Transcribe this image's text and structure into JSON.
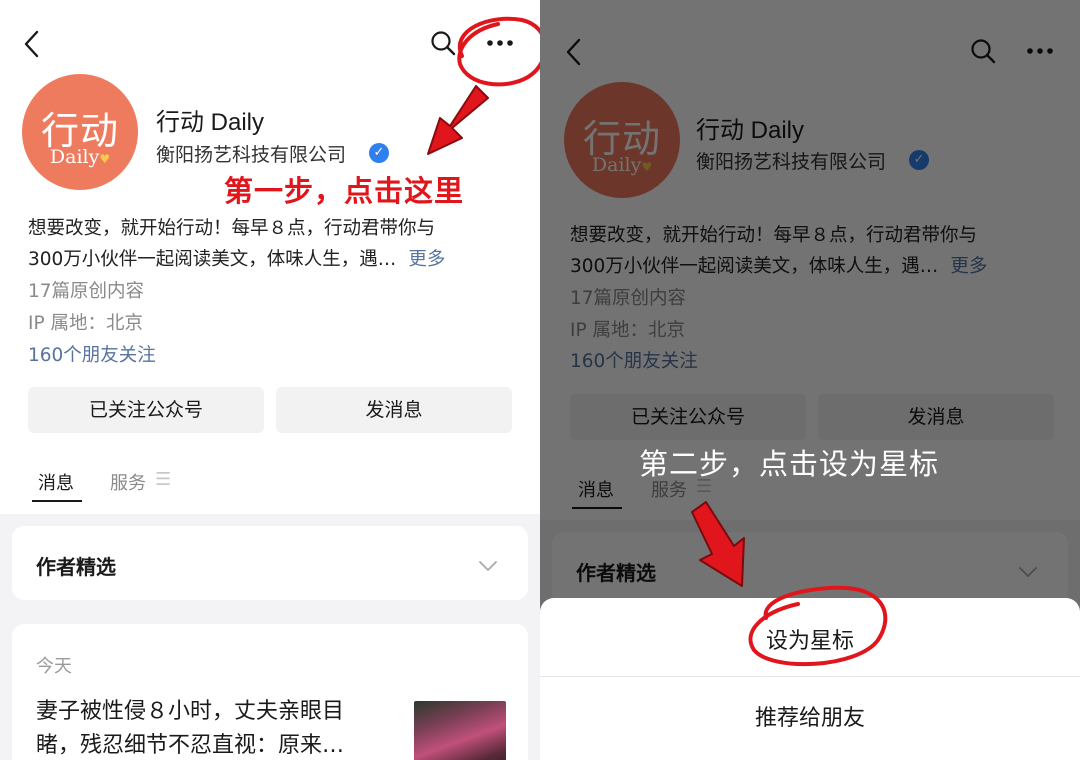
{
  "steps": {
    "step1": "第一步，点击这里",
    "step2": "第二步，点击设为星标"
  },
  "account": {
    "logo_top": "行动",
    "logo_bottom": "Daily",
    "name": "行动 Daily",
    "company": "衡阳扬艺科技有限公司",
    "description_line1": "想要改变，就开始行动！每早８点，行动君带你与",
    "description_line2": "300万小伙伴一起阅读美文，体味人生，遇…",
    "more": "更多",
    "original_count": "17篇原创内容",
    "ip_location": "IP 属地：北京",
    "friends_following": "160个朋友关注"
  },
  "actions": {
    "followed": "已关注公众号",
    "message": "发消息"
  },
  "tabs": {
    "messages": "消息",
    "services": "服务",
    "services_menu_glyph": "☰"
  },
  "sections": {
    "author_picks": "作者精选",
    "today": "今天",
    "article_line1": "妻子被性侵８小时，丈夫亲眼目",
    "article_line2": "睹，残忍细节不忍直视：原来…"
  },
  "sheet": {
    "set_star": "设为星标",
    "recommend": "推荐给朋友"
  },
  "icons": {
    "back": "back-icon",
    "search": "search-icon",
    "more": "more-icon",
    "verified": "verified-badge-icon",
    "chevron": "chevron-down-icon"
  },
  "colors": {
    "annotation_red": "#e0161c",
    "logo_orange": "#ef7b5e",
    "link_blue": "#57739f",
    "verified_blue": "#2f80ed"
  }
}
